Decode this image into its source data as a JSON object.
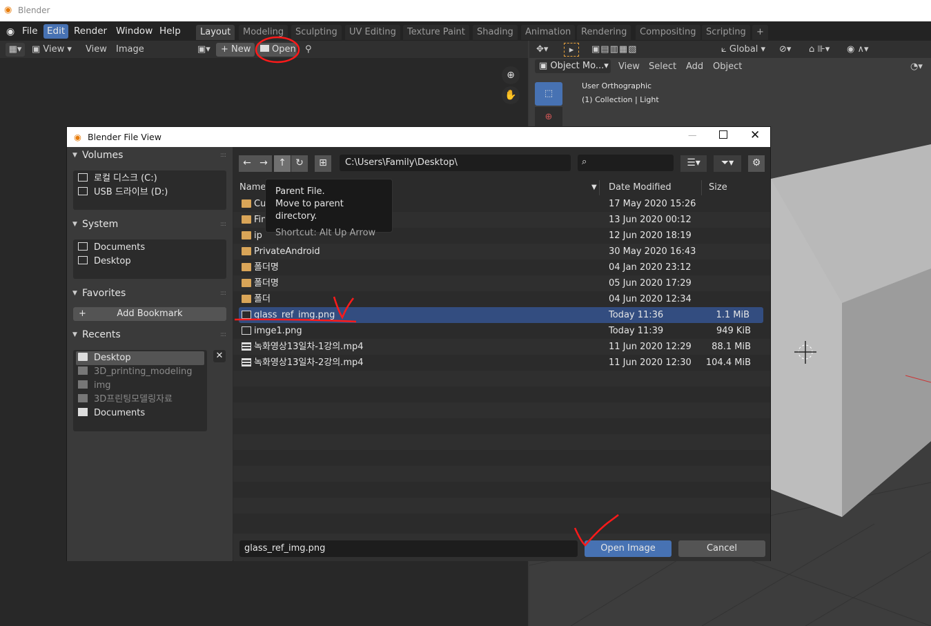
{
  "window": {
    "title": "Blender"
  },
  "menu": {
    "file": "File",
    "edit": "Edit",
    "render": "Render",
    "window": "Window",
    "help": "Help"
  },
  "workspaces": [
    "Layout",
    "Modeling",
    "Sculpting",
    "UV Editing",
    "Texture Paint",
    "Shading",
    "Animation",
    "Rendering",
    "Compositing",
    "Scripting"
  ],
  "image_editor": {
    "view": "View",
    "view2": "View",
    "image": "Image",
    "new": "New",
    "open": "Open"
  },
  "viewport": {
    "transform_orientation": "Global",
    "mode": "Object Mo...",
    "view": "View",
    "select": "Select",
    "add": "Add",
    "object": "Object",
    "overlay_line1": "User Orthographic",
    "overlay_line2": "(1) Collection | Light"
  },
  "dialog": {
    "title": "Blender File View",
    "volumes": {
      "title": "Volumes",
      "items": [
        "로컬 디스크 (C:)",
        "USB 드라이브 (D:)"
      ]
    },
    "system": {
      "title": "System",
      "items": [
        "Documents",
        "Desktop"
      ]
    },
    "favorites": {
      "title": "Favorites",
      "add_bookmark": "Add Bookmark"
    },
    "recents": {
      "title": "Recents",
      "items": [
        "Desktop",
        "3D_printing_modeling",
        "img",
        "3D프린팅모델링자료",
        "Documents"
      ]
    },
    "path": "C:\\Users\\Family\\Desktop\\",
    "columns": {
      "name": "Name",
      "date": "Date Modified",
      "size": "Size"
    },
    "files": [
      {
        "name": "Cu",
        "date": "17 May 2020 15:26",
        "size": "",
        "type": "folder"
      },
      {
        "name": "Fin",
        "date": "13 Jun 2020 00:12",
        "size": "",
        "type": "folder"
      },
      {
        "name": "ip",
        "date": "12 Jun 2020 18:19",
        "size": "",
        "type": "folder"
      },
      {
        "name": "PrivateAndroid",
        "date": "30 May 2020 16:43",
        "size": "",
        "type": "folder"
      },
      {
        "name": "폴더명",
        "date": "04 Jan 2020 23:12",
        "size": "",
        "type": "folder"
      },
      {
        "name": "폴더명",
        "date": "05 Jun 2020 17:29",
        "size": "",
        "type": "folder"
      },
      {
        "name": "폴더",
        "date": "04 Jun 2020 12:34",
        "size": "",
        "type": "folder"
      },
      {
        "name": "glass_ref_img.png",
        "date": "Today 11:36",
        "size": "1.1 MiB",
        "type": "image"
      },
      {
        "name": "imge1.png",
        "date": "Today 11:39",
        "size": "949 KiB",
        "type": "image"
      },
      {
        "name": "녹화영상13일차-1강의.mp4",
        "date": "11 Jun 2020 12:29",
        "size": "88.1 MiB",
        "type": "video"
      },
      {
        "name": "녹화영상13일차-2강의.mp4",
        "date": "11 Jun 2020 12:30",
        "size": "104.4 MiB",
        "type": "video"
      }
    ],
    "tooltip": {
      "line1": "Parent File.",
      "line2": "Move to parent directory.",
      "line3": "Shortcut: Alt Up Arrow"
    },
    "filename": "glass_ref_img.png",
    "open_button": "Open Image",
    "cancel_button": "Cancel"
  },
  "colors": {
    "accent": "#4772b3",
    "selection": "#334d80",
    "folder": "#d9a558",
    "annotation": "#ff1a1a"
  }
}
